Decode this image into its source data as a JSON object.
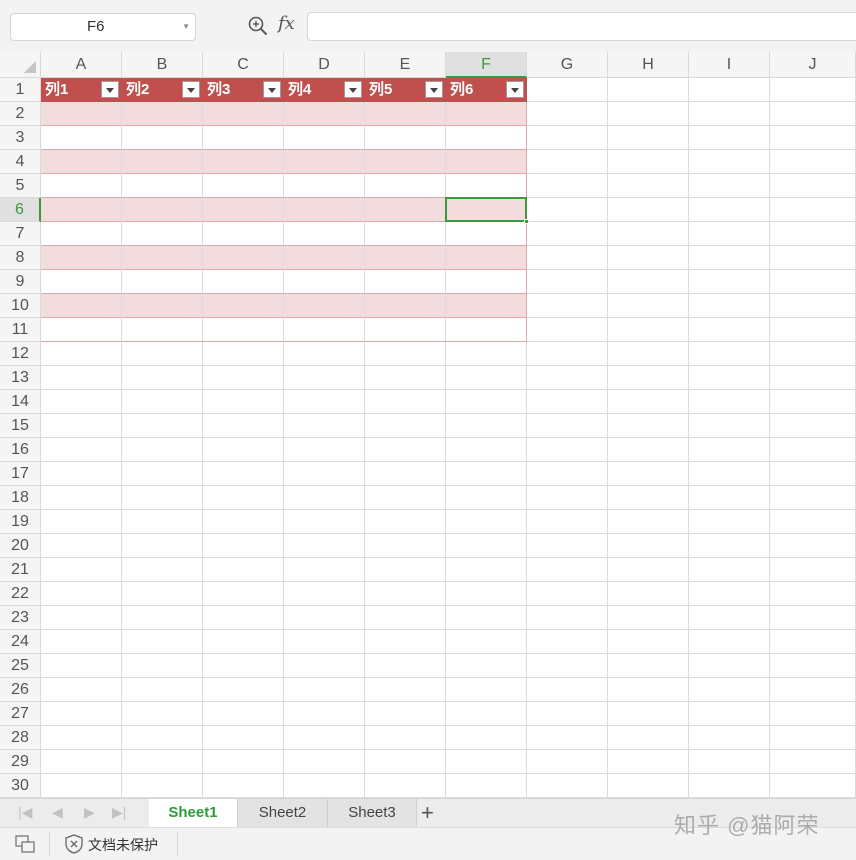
{
  "formula_bar": {
    "cell_ref": "F6",
    "fx_label": "fx",
    "formula_value": ""
  },
  "columns": [
    "A",
    "B",
    "C",
    "D",
    "E",
    "F",
    "G",
    "H",
    "I",
    "J"
  ],
  "selected_column": "F",
  "rows": [
    "1",
    "2",
    "3",
    "4",
    "5",
    "6",
    "7",
    "8",
    "9",
    "10",
    "11",
    "12",
    "13",
    "14",
    "15",
    "16",
    "17",
    "18",
    "19",
    "20",
    "21",
    "22",
    "23",
    "24",
    "25",
    "26",
    "27",
    "28",
    "29",
    "30"
  ],
  "selected_row": "6",
  "table": {
    "headers": [
      "列1",
      "列2",
      "列3",
      "列4",
      "列5",
      "列6"
    ],
    "style_header_color": "#c0504d",
    "style_band_color": "#f2dcdd"
  },
  "sheet_tabs": {
    "tabs": [
      "Sheet1",
      "Sheet2",
      "Sheet3"
    ],
    "active": "Sheet1",
    "add_label": "+"
  },
  "status_bar": {
    "protection_text": "文档未保护"
  },
  "watermark": "知乎 @猫阿荣"
}
